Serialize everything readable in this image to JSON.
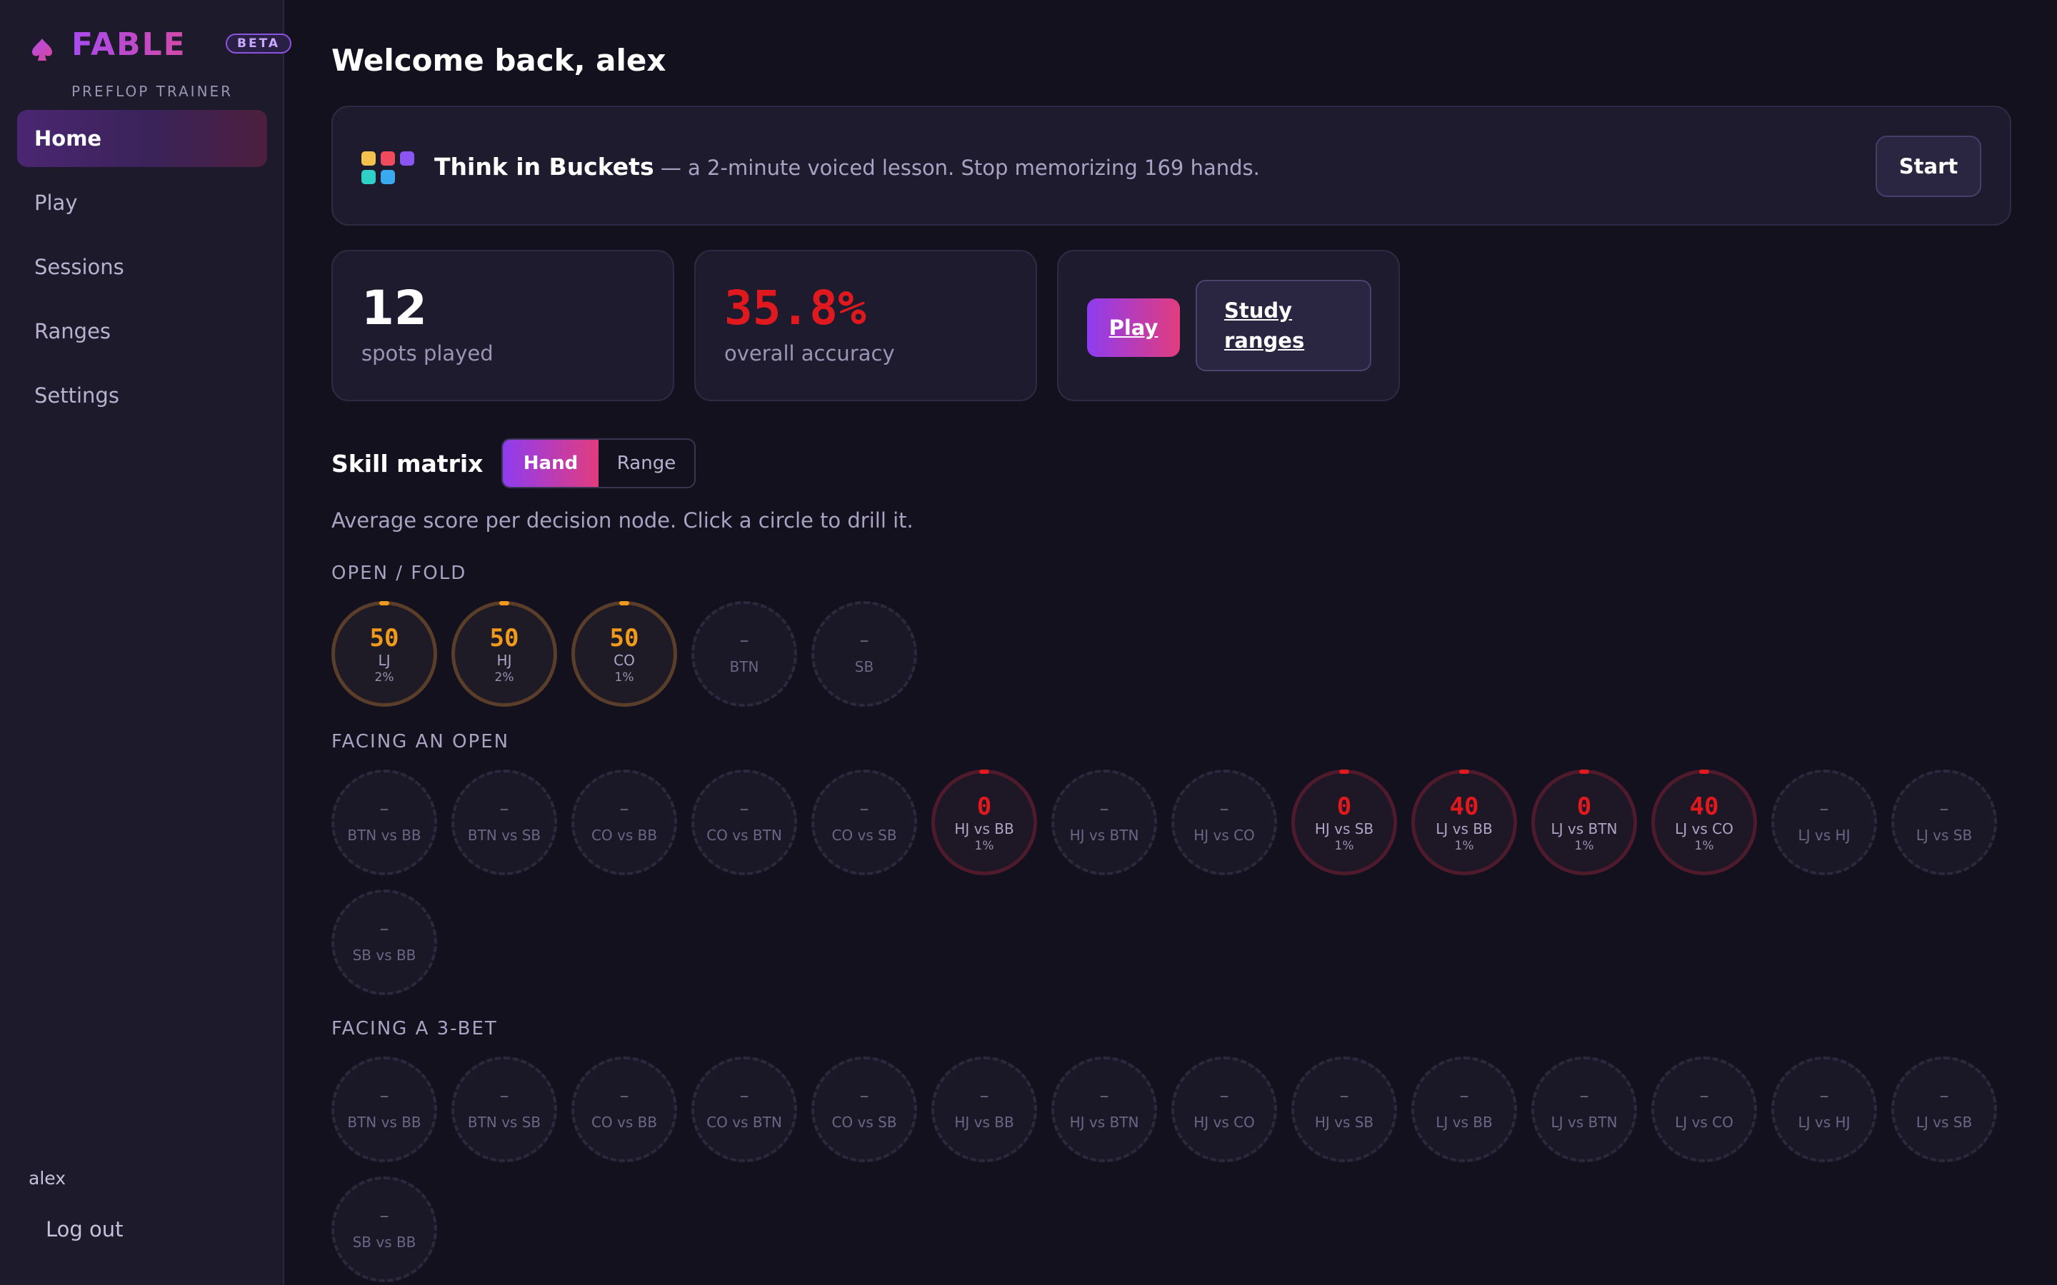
{
  "brand": {
    "name": "FABLE",
    "beta": "BETA",
    "subtitle": "PREFLOP TRAINER"
  },
  "nav": [
    {
      "label": "Home",
      "active": true
    },
    {
      "label": "Play"
    },
    {
      "label": "Sessions"
    },
    {
      "label": "Ranges"
    },
    {
      "label": "Settings"
    }
  ],
  "user": {
    "name": "alex",
    "logout": "Log out"
  },
  "page": {
    "title": "Welcome back, alex"
  },
  "lesson": {
    "title": "Think in Buckets",
    "desc": " — a 2-minute voiced lesson. Stop memorizing 169 hands.",
    "start": "Start"
  },
  "stats": {
    "spots_value": "12",
    "spots_label": "spots played",
    "accuracy_value": "35.8%",
    "accuracy_label": "overall accuracy",
    "accuracy_color": "#e0191e"
  },
  "actions": {
    "play": "Play",
    "study": "Study ranges"
  },
  "skill": {
    "title": "Skill matrix",
    "toggle": [
      "Hand",
      "Range"
    ],
    "active_toggle": "Hand",
    "desc": "Average score per decision node. Click a circle to drill it."
  },
  "colors": {
    "orange": "#f09a1c",
    "red": "#e0191e",
    "accent_purple": "#8e3cf0",
    "accent_pink": "#e23c7d"
  },
  "sections": [
    {
      "label": "OPEN / FOLD",
      "nodes": [
        {
          "label": "LJ",
          "score": "50",
          "pct": "2%",
          "tone": "orange"
        },
        {
          "label": "HJ",
          "score": "50",
          "pct": "2%",
          "tone": "orange"
        },
        {
          "label": "CO",
          "score": "50",
          "pct": "1%",
          "tone": "orange"
        },
        {
          "label": "BTN",
          "score": "–"
        },
        {
          "label": "SB",
          "score": "–"
        }
      ]
    },
    {
      "label": "FACING AN OPEN",
      "nodes": [
        {
          "label": "BTN vs BB",
          "score": "–"
        },
        {
          "label": "BTN vs SB",
          "score": "–"
        },
        {
          "label": "CO vs BB",
          "score": "–"
        },
        {
          "label": "CO vs BTN",
          "score": "–"
        },
        {
          "label": "CO vs SB",
          "score": "–"
        },
        {
          "label": "HJ vs BB",
          "score": "0",
          "pct": "1%",
          "tone": "red"
        },
        {
          "label": "HJ vs BTN",
          "score": "–"
        },
        {
          "label": "HJ vs CO",
          "score": "–"
        },
        {
          "label": "HJ vs SB",
          "score": "0",
          "pct": "1%",
          "tone": "red"
        },
        {
          "label": "LJ vs BB",
          "score": "40",
          "pct": "1%",
          "tone": "red"
        },
        {
          "label": "LJ vs BTN",
          "score": "0",
          "pct": "1%",
          "tone": "red"
        },
        {
          "label": "LJ vs CO",
          "score": "40",
          "pct": "1%",
          "tone": "red"
        },
        {
          "label": "LJ vs HJ",
          "score": "–"
        },
        {
          "label": "LJ vs SB",
          "score": "–"
        },
        {
          "label": "SB vs BB",
          "score": "–"
        }
      ]
    },
    {
      "label": "FACING A 3-BET",
      "nodes": [
        {
          "label": "BTN vs BB",
          "score": "–"
        },
        {
          "label": "BTN vs SB",
          "score": "–"
        },
        {
          "label": "CO vs BB",
          "score": "–"
        },
        {
          "label": "CO vs BTN",
          "score": "–"
        },
        {
          "label": "CO vs SB",
          "score": "–"
        },
        {
          "label": "HJ vs BB",
          "score": "–"
        },
        {
          "label": "HJ vs BTN",
          "score": "–"
        },
        {
          "label": "HJ vs CO",
          "score": "–"
        },
        {
          "label": "HJ vs SB",
          "score": "–"
        },
        {
          "label": "LJ vs BB",
          "score": "–"
        },
        {
          "label": "LJ vs BTN",
          "score": "–"
        },
        {
          "label": "LJ vs CO",
          "score": "–"
        },
        {
          "label": "LJ vs HJ",
          "score": "–"
        },
        {
          "label": "LJ vs SB",
          "score": "–"
        },
        {
          "label": "SB vs BB",
          "score": "–"
        }
      ]
    }
  ]
}
